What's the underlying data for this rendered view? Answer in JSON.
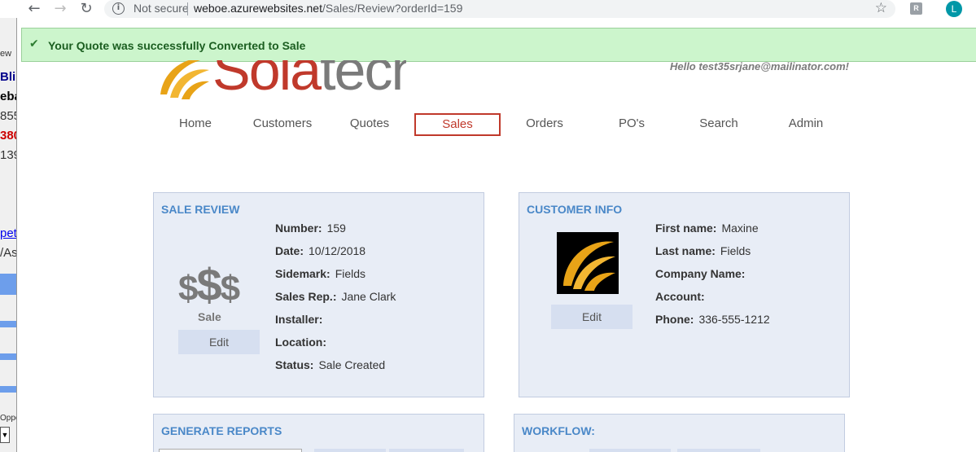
{
  "browser": {
    "back_icon": "arrow-left-icon",
    "forward_icon": "arrow-right-icon",
    "reload_icon": "reload-icon",
    "security_label": "Not secure",
    "url_host": "weboe.azurewebsites.net",
    "url_path": "/Sales/Review?orderId=159",
    "profile_initial": "L"
  },
  "background_window": {
    "fragments": [
      "ew",
      "Blin",
      "eba",
      "855",
      "380",
      "139",
      "pet",
      "/As",
      "Oppo"
    ]
  },
  "banner": {
    "message": "Your Quote was successfully Converted to Sale",
    "color": "#ccf5cc"
  },
  "header": {
    "logo_text_a": "Sola",
    "logo_text_b": "tech",
    "greeting": "Hello test35srjane@mailinator.com!"
  },
  "nav": {
    "items": [
      "Home",
      "Customers",
      "Quotes",
      "Sales",
      "Orders",
      "PO's",
      "Search",
      "Admin"
    ],
    "active": "Sales",
    "active_color": "#c0392b"
  },
  "sale_review": {
    "title": "SALE REVIEW",
    "icon_text": "$$$",
    "icon_caption": "Sale",
    "edit_label": "Edit",
    "fields": [
      {
        "label": "Number:",
        "value": "159"
      },
      {
        "label": "Date:",
        "value": "10/12/2018"
      },
      {
        "label": "Sidemark:",
        "value": "Fields"
      },
      {
        "label": "Sales Rep.:",
        "value": "Jane Clark"
      },
      {
        "label": "Installer:",
        "value": ""
      },
      {
        "label": "Location:",
        "value": ""
      },
      {
        "label": "Status:",
        "value": "Sale Created"
      }
    ]
  },
  "customer_info": {
    "title": "CUSTOMER INFO",
    "edit_label": "Edit",
    "fields": [
      {
        "label": "First name:",
        "value": "Maxine"
      },
      {
        "label": "Last name:",
        "value": "Fields"
      },
      {
        "label": "Company Name:",
        "value": ""
      },
      {
        "label": "Account:",
        "value": ""
      },
      {
        "label": "Phone:",
        "value": "336-555-1212"
      }
    ]
  },
  "generate_reports": {
    "title": "GENERATE REPORTS"
  },
  "workflow": {
    "title": "WORKFLOW:"
  },
  "colors": {
    "panel_bg": "#e8edf6",
    "panel_title": "#4a88c8",
    "brand_red": "#c0392b"
  }
}
